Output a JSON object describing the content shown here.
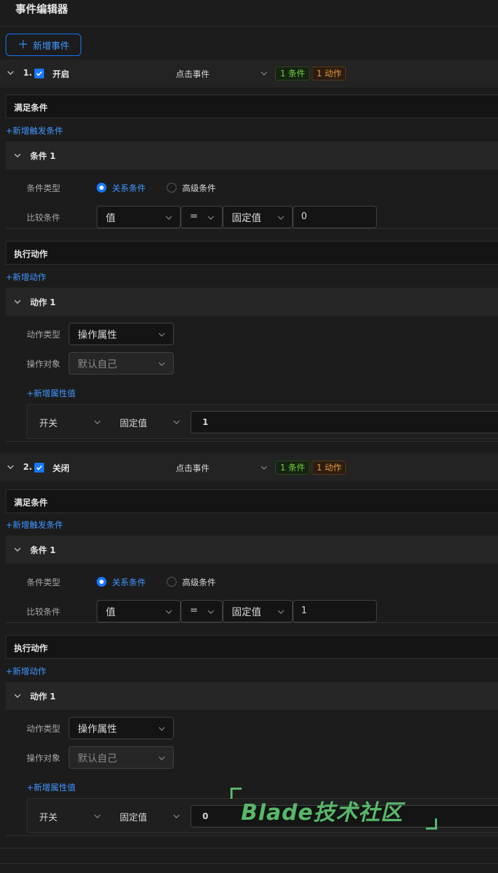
{
  "header": {
    "title": "事件编辑器"
  },
  "toolbar": {
    "add_event_label": "新增事件"
  },
  "events": [
    {
      "index": "1.",
      "checked": true,
      "name": "开启",
      "event_type": "点击事件",
      "cond_tag": "1 条件",
      "action_tag": "1 动作",
      "conditions_title": "满足条件",
      "add_condition_label": "+新增触发条件",
      "condition": {
        "title": "条件 1",
        "type_label": "条件类型",
        "type_options": [
          "关系条件",
          "高级条件"
        ],
        "compare_label": "比较条件",
        "left": "值",
        "operator": "=",
        "right_mode": "固定值",
        "right_value": "0"
      },
      "actions_title": "执行动作",
      "add_action_label": "+新增动作",
      "action": {
        "title": "动作 1",
        "type_label": "动作类型",
        "type_value": "操作属性",
        "target_label": "操作对象",
        "target_value": "默认自己",
        "add_prop_label": "+新增属性值",
        "prop_key": "开关",
        "prop_mode": "固定值",
        "prop_value": "1"
      }
    },
    {
      "index": "2.",
      "checked": true,
      "name": "关闭",
      "event_type": "点击事件",
      "cond_tag": "1 条件",
      "action_tag": "1 动作",
      "conditions_title": "满足条件",
      "add_condition_label": "+新增触发条件",
      "condition": {
        "title": "条件 1",
        "type_label": "条件类型",
        "type_options": [
          "关系条件",
          "高级条件"
        ],
        "compare_label": "比较条件",
        "left": "值",
        "operator": "=",
        "right_mode": "固定值",
        "right_value": "1"
      },
      "actions_title": "执行动作",
      "add_action_label": "+新增动作",
      "action": {
        "title": "动作 1",
        "type_label": "动作类型",
        "type_value": "操作属性",
        "target_label": "操作对象",
        "target_value": "默认自己",
        "add_prop_label": "+新增属性值",
        "prop_key": "开关",
        "prop_mode": "固定值",
        "prop_value": "0"
      }
    }
  ],
  "watermark": {
    "text": "Blade技术社区"
  },
  "colors": {
    "accent": "#1677ff",
    "cond_tag": "#73d13d",
    "action_tag": "#e89a3c",
    "background": "#1c1c1c"
  },
  "icons": {
    "expand": "chevron-down-icon",
    "check": "check-icon",
    "add": "plus-icon"
  }
}
